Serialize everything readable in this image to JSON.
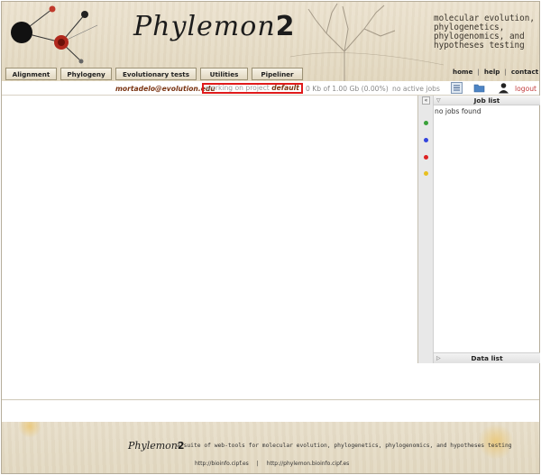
{
  "header": {
    "brand_main": "Phylemon",
    "brand_num": "2",
    "tagline": [
      "molecular evolution,",
      "phylogenetics,",
      "phylogenomics, and",
      "hypotheses testing"
    ],
    "tabs": [
      "Alignment",
      "Phylogeny",
      "Evolutionary tests",
      "Utilities",
      "Pipeliner"
    ],
    "links": {
      "home": "home",
      "help": "help",
      "contact": "contact",
      "sep": "|"
    }
  },
  "status": {
    "email": "mortadelo@evolution.edu",
    "project_prefix": "working on project ",
    "project_name": "default",
    "space": "0 Kb of 1.00 Gb (0.00%)",
    "jobs": "no active jobs",
    "logout": "logout",
    "icons": [
      "list-icon",
      "folder-icon",
      "user-icon"
    ]
  },
  "side": {
    "collapse": "«",
    "job_list_title": "Job list",
    "job_list_empty": "no jobs found",
    "data_list_title": "Data list",
    "status_dots": [
      "#3aa13a",
      "#3344dd",
      "#dd2222",
      "#e8c020"
    ]
  },
  "footer": {
    "brand_main": "Phylemon",
    "brand_num": "2",
    "tagline": "a suite of web-tools for molecular evolution, phylogenetics, phylogenomics, and hypotheses testing",
    "link1": "http://bioinfo.cipf.es",
    "sep": "|",
    "link2": "http://phylemon.bioinfo.cipf.es"
  }
}
